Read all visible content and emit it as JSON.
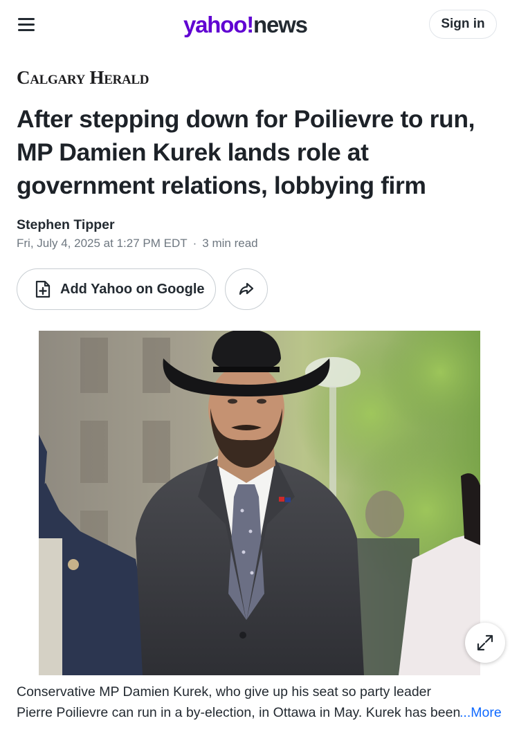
{
  "nav": {
    "logo_main": "yahoo",
    "logo_bang": "!",
    "logo_news": "news",
    "signin_label": "Sign in",
    "menu_icon": "hamburger-icon"
  },
  "article": {
    "publisher": "Calgary Herald",
    "headline": "After stepping down for Poilievre to run, MP Damien Kurek lands role at government relations, lobbying firm",
    "author": "Stephen Tipper",
    "date": "Fri, July 4, 2025 at 1:27 PM EDT",
    "separator": "·",
    "read_time": "3 min read"
  },
  "actions": {
    "add_google_label": "Add Yahoo on Google",
    "add_google_icon": "add-document-icon",
    "share_icon": "share-arrow-icon"
  },
  "photo": {
    "expand_icon": "expand-arrows-icon"
  },
  "caption": {
    "line1": "Conservative MP Damien Kurek, who give up his seat so party leader",
    "line2": "Pierre Poilievre can run in a by-election, in Ottawa in May. Kurek has been",
    "more": "...More"
  },
  "colors": {
    "brand": "#6001d2",
    "link": "#0f69ff",
    "text": "#232a31",
    "muted": "#6e7780"
  }
}
